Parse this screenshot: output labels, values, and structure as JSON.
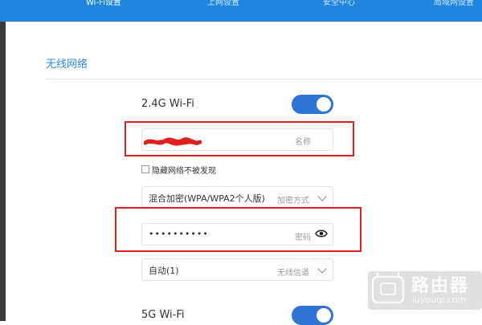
{
  "nav": {
    "tabs": [
      "Wi-Fi设置",
      "上网设置",
      "安全中心",
      "局域网设置"
    ],
    "active_index": 0
  },
  "section": {
    "title": "无线网络"
  },
  "wifi24": {
    "label": "2.4G Wi-Fi",
    "enabled": true,
    "name_placeholder": "名称",
    "hide_network_label": "隐藏网络不被发现",
    "hide_network_checked": false,
    "encryption_value": "混合加密(WPA/WPA2个人版)",
    "encryption_placeholder": "加密方式",
    "password_value": "••••••••••",
    "password_placeholder": "密码",
    "channel_value": "自动(1)",
    "channel_placeholder": "无线信道"
  },
  "wifi5": {
    "label": "5G Wi-Fi",
    "enabled": true
  },
  "watermark": {
    "brand": "路由器",
    "domain": "luyouqi.com"
  },
  "colors": {
    "nav": "#1f86e0",
    "accent": "#2d8ae6",
    "toggle": "#2d74d6",
    "annotation": "#e02020"
  }
}
